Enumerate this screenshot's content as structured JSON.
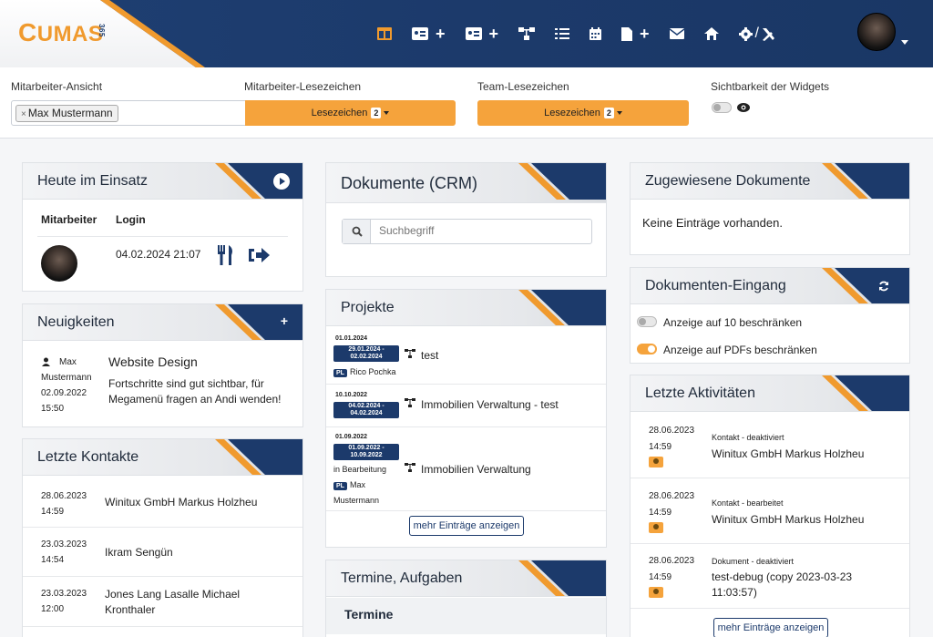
{
  "header": {
    "logo_c": "C",
    "logo_text": "UMAS",
    "logo_num": "365",
    "nav_icons": [
      "dashboard-icon",
      "contact-card-icon",
      "add-icon",
      "contact-card-icon",
      "add-icon",
      "org-chart-icon",
      "task-list-icon",
      "calendar-icon",
      "document-icon",
      "add-icon",
      "mail-icon",
      "home-icon",
      "settings-icon",
      "tools-icon"
    ],
    "settings_sep": "/",
    "plus": "+"
  },
  "filters": {
    "employee_view_label": "Mitarbeiter-Ansicht",
    "employee_tag": "Max Mustermann",
    "tag_remove": "×",
    "employee_bookmarks_label": "Mitarbeiter-Lesezeichen",
    "bookmarks_button": "Lesezeichen",
    "bookmarks_count": "2",
    "team_bookmarks_label": "Team-Lesezeichen",
    "team_button": "Lesezeichen",
    "team_count": "2",
    "widget_visibility_label": "Sichtbarkeit der Widgets"
  },
  "heute": {
    "title": "Heute im Einsatz",
    "col_employee": "Mitarbeiter",
    "col_login": "Login",
    "login_time": "04.02.2024 21:07"
  },
  "news": {
    "title": "Neuigkeiten",
    "add": "+",
    "author_first": "Max",
    "author_last": "Mustermann",
    "date": "02.09.2022",
    "time": "15:50",
    "headline": "Website Design",
    "text_line1": "Fortschritte sind gut sichtbar, für",
    "text_line2": "Megamenü fragen an Andi wenden!"
  },
  "contacts": {
    "title": "Letzte Kontakte",
    "rows": [
      {
        "date": "28.06.2023",
        "time": "14:59",
        "name": "Winitux GmbH Markus Holzheu",
        "name2": ""
      },
      {
        "date": "23.03.2023",
        "time": "14:54",
        "name": "Ikram Sengün",
        "name2": ""
      },
      {
        "date": "23.03.2023",
        "time": "12:00",
        "name": "Jones Lang Lasalle Michael",
        "name2": "Kronthaler"
      }
    ]
  },
  "docs": {
    "title": "Dokumente (CRM)",
    "search_placeholder": "Suchbegriff"
  },
  "projects": {
    "title": "Projekte",
    "items": [
      {
        "date": "01.01.2024",
        "range1": "29.01.2024 -",
        "range2": "02.02.2024",
        "name": "test",
        "status": "",
        "pl": "PL",
        "lead": "Rico Pochka",
        "lead2": ""
      },
      {
        "date": "10.10.2022",
        "range1": "04.02.2024 -",
        "range2": "04.02.2024",
        "name": "Immobilien Verwaltung - test",
        "status": "",
        "pl": "",
        "lead": "",
        "lead2": ""
      },
      {
        "date": "01.09.2022",
        "range1": "01.09.2022 -",
        "range2": "10.09.2022",
        "name": "Immobilien Verwaltung",
        "status": "in Bearbeitung",
        "pl": "PL",
        "lead": "Max",
        "lead2": "Mustermann"
      }
    ],
    "more": "mehr Einträge anzeigen"
  },
  "termine": {
    "title": "Termine, Aufgaben",
    "sub": "Termine"
  },
  "assigned": {
    "title": "Zugewiesene Dokumente",
    "empty": "Keine Einträge vorhanden."
  },
  "inbox": {
    "title": "Dokumenten-Eingang",
    "opt1": "Anzeige auf 10 beschränken",
    "opt2": "Anzeige auf PDFs beschränken"
  },
  "activities": {
    "title": "Letzte Aktivitäten",
    "rows": [
      {
        "date": "28.06.2023",
        "time": "14:59",
        "kind": "Kontakt - deaktiviert",
        "name": "Winitux GmbH Markus Holzheu",
        "name2": ""
      },
      {
        "date": "28.06.2023",
        "time": "14:59",
        "kind": "Kontakt - bearbeitet",
        "name": "Winitux GmbH Markus Holzheu",
        "name2": ""
      },
      {
        "date": "28.06.2023",
        "time": "14:59",
        "kind": "Dokument - deaktiviert",
        "name": "test-debug (copy 2023-03-23",
        "name2": "11:03:57)"
      }
    ],
    "more": "mehr Einträge anzeigen"
  },
  "colors": {
    "primary": "#1c3a6b",
    "accent": "#f09a2e",
    "button": "#f5a33c"
  }
}
